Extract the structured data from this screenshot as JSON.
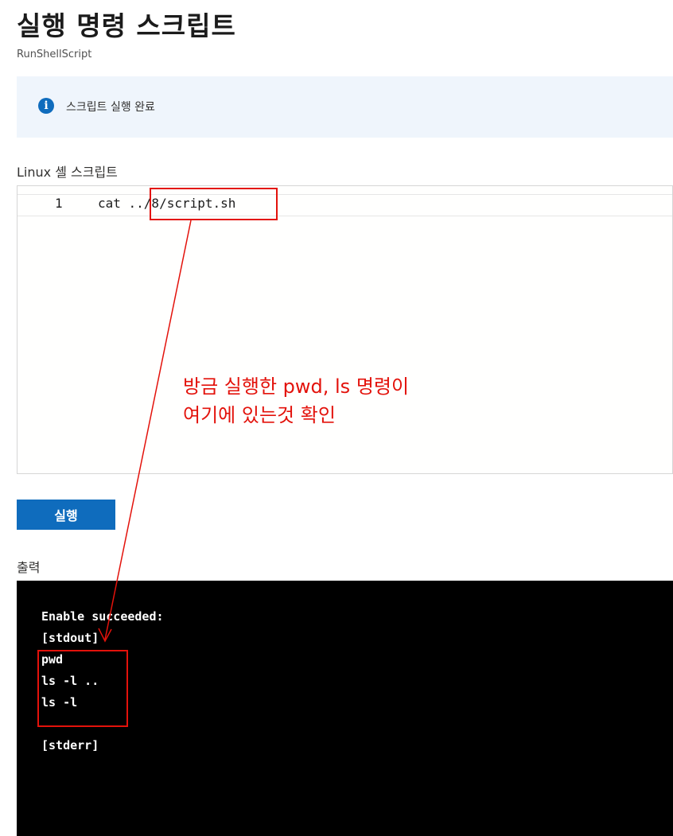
{
  "header": {
    "title": "실행 명령 스크립트",
    "subtitle": "RunShellScript"
  },
  "info_banner": {
    "icon": "info-icon",
    "icon_glyph": "i",
    "message": "스크립트 실행 완료"
  },
  "script_editor": {
    "label": "Linux 셸 스크립트",
    "lines": [
      {
        "number": "1",
        "code": "cat ../8/script.sh"
      }
    ]
  },
  "run_button": {
    "label": "실행"
  },
  "output": {
    "label": "출력",
    "lines": [
      "Enable succeeded:",
      "[stdout]",
      "pwd",
      "ls -l ..",
      "ls -l",
      "",
      "[stderr]"
    ]
  },
  "annotation": {
    "line1": "방금 실행한 pwd, ls 명령이",
    "line2": "여기에 있는것 확인",
    "color": "#e3120b"
  },
  "colors": {
    "accent": "#0f6cbd",
    "banner_bg": "#eff5fc",
    "console_bg": "#000000",
    "annotation": "#e3120b"
  }
}
